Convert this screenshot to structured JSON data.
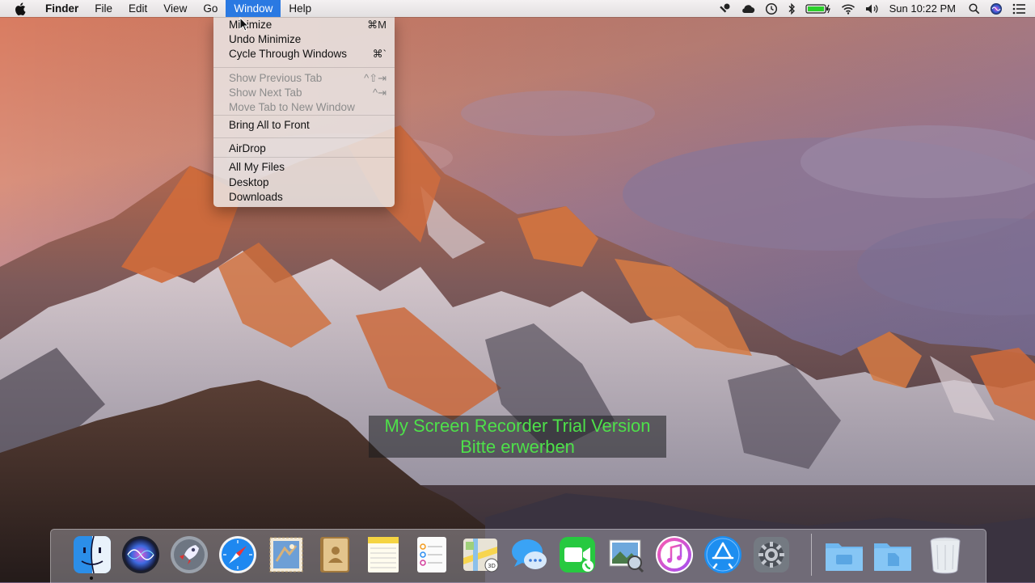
{
  "menubar": {
    "apple_icon": "apple-logo-icon",
    "app_name": "Finder",
    "menus": [
      "File",
      "Edit",
      "View",
      "Go",
      "Window",
      "Help"
    ],
    "active_menu": "Window",
    "status": {
      "icons": [
        "key-icon",
        "cloud-icon",
        "time-machine-icon",
        "bluetooth-icon",
        "battery-icon",
        "wifi-icon",
        "volume-icon"
      ],
      "clock": "Sun 10:22 PM",
      "right_icons": [
        "spotlight-icon",
        "siri-icon",
        "notification-center-icon"
      ]
    }
  },
  "window_menu": {
    "items": [
      {
        "label": "Minimize",
        "shortcut": "⌘M",
        "enabled": true
      },
      {
        "label": "Undo Minimize",
        "shortcut": "",
        "enabled": true
      },
      {
        "label": "Cycle Through Windows",
        "shortcut": "⌘`",
        "enabled": true
      },
      {
        "label": "Show Previous Tab",
        "shortcut": "^⇧⇥",
        "enabled": false
      },
      {
        "label": "Show Next Tab",
        "shortcut": "^⇥",
        "enabled": false
      },
      {
        "label": "Move Tab to New Window",
        "shortcut": "",
        "enabled": false
      },
      {
        "label": "Bring All to Front",
        "shortcut": "",
        "enabled": true
      },
      {
        "label": "AirDrop",
        "shortcut": "",
        "enabled": true
      },
      {
        "label": "All My Files",
        "shortcut": "",
        "enabled": true
      },
      {
        "label": "Desktop",
        "shortcut": "",
        "enabled": true
      },
      {
        "label": "Downloads",
        "shortcut": "",
        "enabled": true
      }
    ]
  },
  "watermark": {
    "line1": "My Screen Recorder Trial Version",
    "line2": "Bitte erwerben",
    "color": "#4ee04a"
  },
  "dock": {
    "apps": [
      "finder-icon",
      "siri-icon",
      "launchpad-icon",
      "safari-icon",
      "mail-icon",
      "contacts-icon",
      "notes-icon",
      "reminders-icon",
      "maps-icon",
      "messages-icon",
      "facetime-icon",
      "preview-icon",
      "itunes-icon",
      "app-store-icon",
      "system-preferences-icon"
    ],
    "others": [
      "applications-folder-icon",
      "documents-folder-icon",
      "trash-icon"
    ],
    "running": [
      "finder-icon"
    ]
  }
}
